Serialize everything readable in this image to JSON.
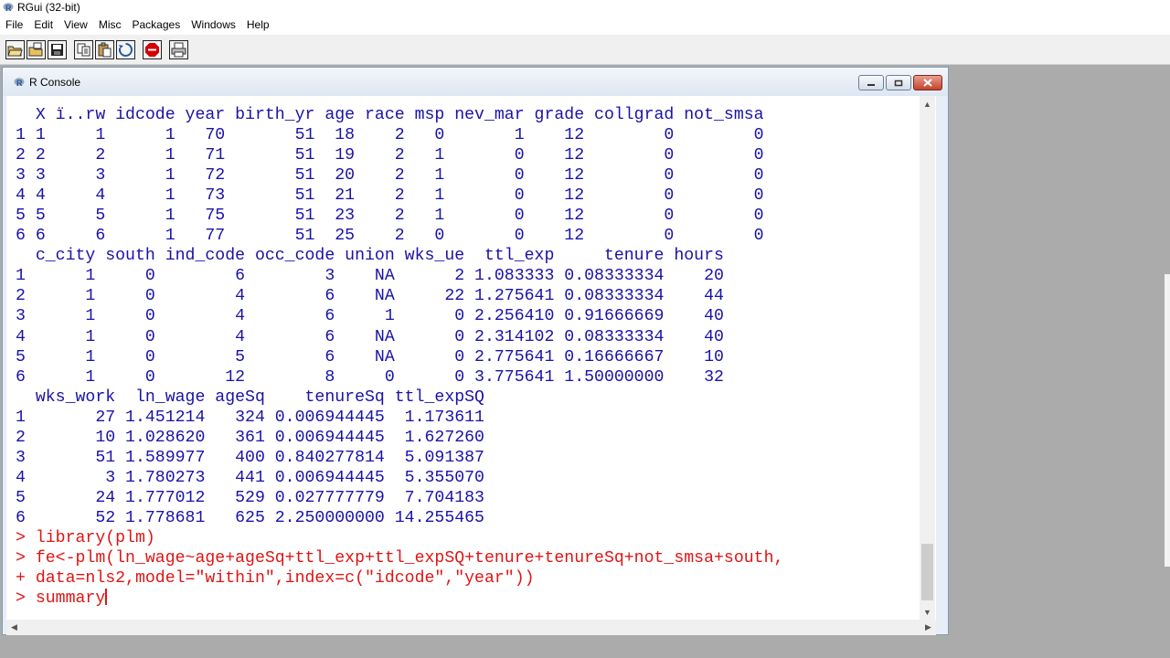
{
  "app": {
    "title": "RGui (32-bit)"
  },
  "menu": [
    "File",
    "Edit",
    "View",
    "Misc",
    "Packages",
    "Windows",
    "Help"
  ],
  "toolbar": {
    "icons": [
      "open-script-icon",
      "load-workspace-icon",
      "save-workspace-icon",
      "copy-icon",
      "paste-icon",
      "copy-paste-icon",
      "stop-icon",
      "print-icon"
    ],
    "stop_color": "#d40000"
  },
  "console": {
    "title": "R Console",
    "text_color": "#1a12a8",
    "prompt_color": "#e01414",
    "output_lines": [
      "  X ï..rw idcode year birth_yr age race msp nev_mar grade collgrad not_smsa",
      "1 1     1      1   70       51  18    2   0       1    12        0        0",
      "2 2     2      1   71       51  19    2   1       0    12        0        0",
      "3 3     3      1   72       51  20    2   1       0    12        0        0",
      "4 4     4      1   73       51  21    2   1       0    12        0        0",
      "5 5     5      1   75       51  23    2   1       0    12        0        0",
      "6 6     6      1   77       51  25    2   0       0    12        0        0",
      "  c_city south ind_code occ_code union wks_ue  ttl_exp     tenure hours",
      "1      1     0        6        3    NA      2 1.083333 0.08333334    20",
      "2      1     0        4        6    NA     22 1.275641 0.08333334    44",
      "3      1     0        4        6     1      0 2.256410 0.91666669    40",
      "4      1     0        4        6    NA      0 2.314102 0.08333334    40",
      "5      1     0        5        6    NA      0 2.775641 0.16666667    10",
      "6      1     0       12        8     0      0 3.775641 1.50000000    32",
      "  wks_work  ln_wage ageSq    tenureSq ttl_expSQ",
      "1       27 1.451214   324 0.006944445  1.173611",
      "2       10 1.028620   361 0.006944445  1.627260",
      "3       51 1.589977   400 0.840277814  5.091387",
      "4        3 1.780273   441 0.006944445  5.355070",
      "5       24 1.777012   529 0.027777779  7.704183",
      "6       52 1.778681   625 2.250000000 14.255465"
    ],
    "command_lines": [
      "> library(plm)",
      "> fe<-plm(ln_wage~age+ageSq+ttl_exp+ttl_expSQ+tenure+tenureSq+not_smsa+south,",
      "+ data=nls2,model=\"within\",index=c(\"idcode\",\"year\"))",
      "> summary"
    ]
  }
}
